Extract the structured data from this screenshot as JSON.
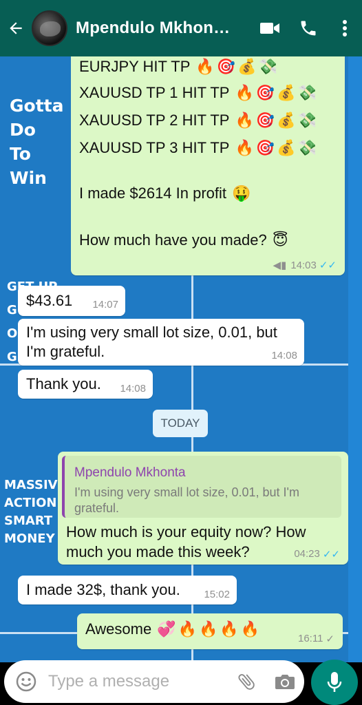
{
  "header": {
    "contact_name": "Mpendulo Mkhon…"
  },
  "background": {
    "poster_top": [
      "Gotta",
      "Do",
      "To",
      "Win"
    ],
    "poster_mid": [
      "GET UP",
      "G",
      "O",
      "G"
    ],
    "poster_bottom": [
      "MASSIVE",
      "ACTION",
      "SMART",
      "MONEY"
    ]
  },
  "messages": {
    "m1": {
      "lines": [
        "EURJPY HIT TP",
        "XAUUSD TP 1 HIT TP",
        "XAUUSD TP 2 HIT TP",
        "XAUUSD TP 3 HIT TP"
      ],
      "profit": "I made $2614 In profit",
      "question": "How much have you made?",
      "time": "14:03"
    },
    "m2": {
      "text": "$43.61",
      "time": "14:07"
    },
    "m3": {
      "text": "I'm using very small lot size, 0.01, but I'm grateful.",
      "time": "14:08"
    },
    "m4": {
      "text": "Thank you.",
      "time": "14:08"
    },
    "divider": "TODAY",
    "m5": {
      "quote_author": "Mpendulo Mkhonta",
      "quote_text": "I'm using very small lot size, 0.01, but I'm grateful.",
      "text": "How much is your equity now? How much you made this week?",
      "time": "04:23"
    },
    "m6": {
      "text": "I made 32$, thank you.",
      "time": "15:02"
    },
    "m7": {
      "text": "Awesome",
      "time": "16:11"
    }
  },
  "composer": {
    "placeholder": "Type a message"
  },
  "colors": {
    "header": "#075e54",
    "outgoing": "#dcf8c6",
    "incoming": "#ffffff",
    "read_tick": "#34b7f1",
    "quote_author": "#8e44ad",
    "fab": "#00897b"
  }
}
